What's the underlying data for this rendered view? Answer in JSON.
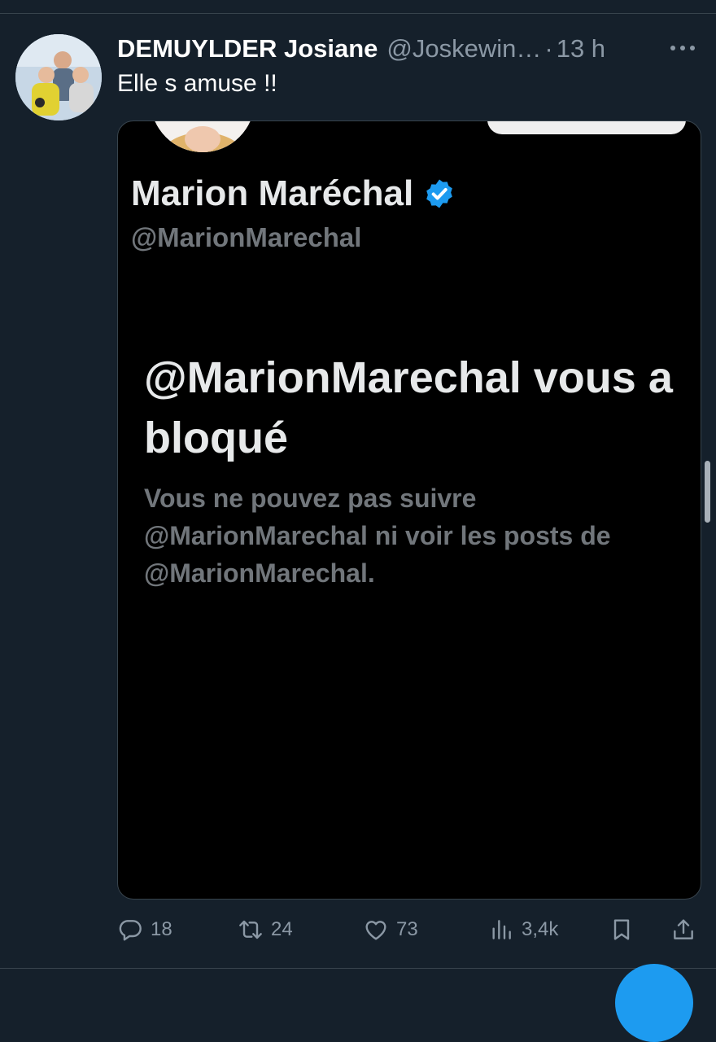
{
  "tweet": {
    "author_name": "DEMUYLDER Josiane",
    "author_handle": "@Joskewin…",
    "separator": "·",
    "timestamp": "13 h",
    "text": "Elle s amuse !!"
  },
  "embedded": {
    "profile_name": "Marion Maréchal",
    "profile_handle": "@MarionMarechal",
    "blocked_title": "@MarionMarechal vous a bloqué",
    "blocked_description": "Vous ne pouvez pas suivre @MarionMarechal ni voir les posts de @MarionMarechal."
  },
  "actions": {
    "replies": "18",
    "retweets": "24",
    "likes": "73",
    "views": "3,4k"
  },
  "icons": {
    "more": "more-horizontal-icon",
    "reply": "reply-icon",
    "retweet": "retweet-icon",
    "like": "heart-icon",
    "views": "views-icon",
    "bookmark": "bookmark-icon",
    "share": "share-icon",
    "verified": "verified-badge-icon"
  },
  "colors": {
    "background": "#15202b",
    "card_background": "#000000",
    "accent": "#1d9bf0",
    "muted_text": "#8b98a5"
  }
}
